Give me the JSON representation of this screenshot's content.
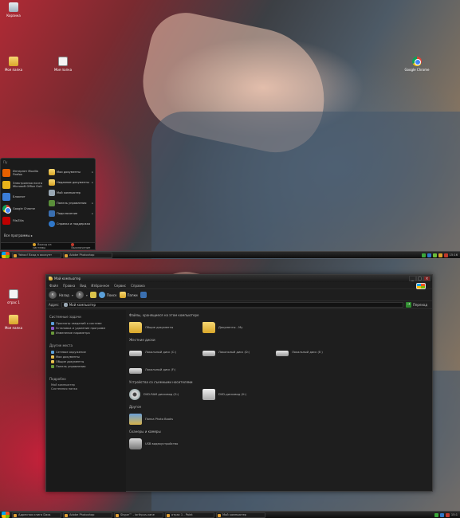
{
  "top": {
    "desktop_icons": [
      {
        "label": "Корзина",
        "icon": "recycle-bin-icon"
      },
      {
        "label": "Моя папка",
        "icon": "folder-icon"
      },
      {
        "label": "Моя папка",
        "icon": "document-icon"
      },
      {
        "label": "Google Chrome",
        "icon": "chrome-icon"
      }
    ],
    "start_menu": {
      "user": "Пу",
      "programs": [
        {
          "label": "Интернет Mozilla Firefox",
          "icon": "firefox-icon",
          "color": "#e66000"
        },
        {
          "label": "Электронная почта Microsoft Office Outl",
          "icon": "outlook-icon",
          "color": "#e8b21a"
        },
        {
          "label": "Блокнот",
          "icon": "notepad-icon",
          "color": "#3b7dd8"
        },
        {
          "label": "Google Chrome",
          "icon": "chrome-icon",
          "color": "#34a853"
        },
        {
          "label": "FileZilla",
          "icon": "filezilla-icon",
          "color": "#bf0000"
        }
      ],
      "places": [
        {
          "label": "Мои документы",
          "icon": "documents-icon",
          "arrow": "▸"
        },
        {
          "label": "Недавние документы",
          "icon": "recent-docs-icon",
          "arrow": "▸"
        },
        {
          "label": "Мой компьютер",
          "icon": "my-computer-icon",
          "arrow": ""
        },
        {
          "label": "Панель управления",
          "icon": "control-panel-icon",
          "arrow": "▸"
        },
        {
          "label": "Подключение",
          "icon": "connect-icon",
          "arrow": "▸"
        },
        {
          "label": "Справка и поддержка",
          "icon": "help-icon",
          "arrow": ""
        }
      ],
      "all_programs": "Все программы ▸",
      "logoff": "Выход из системы",
      "shutdown": "Выключение"
    },
    "taskbar": {
      "items": [
        "Yahoo! Вход в аккаунт",
        "Adobe Photoshop"
      ],
      "clock": "15:16"
    }
  },
  "bottom": {
    "desktop_icons": [
      {
        "label": "отрас 1",
        "icon": "document-icon"
      },
      {
        "label": "Моя папка",
        "icon": "folder-icon"
      }
    ],
    "explorer": {
      "title": "Мой компьютер",
      "menu": [
        "Файл",
        "Правка",
        "Вид",
        "Избранное",
        "Сервис",
        "Справка"
      ],
      "toolbar": {
        "back": "Назад",
        "search": "Поиск",
        "folders": "Папки"
      },
      "address": {
        "label": "Адрес",
        "value": "Мой компьютер",
        "go": "Переход"
      },
      "tasks": [
        {
          "title": "Системные задачи",
          "links": [
            "Просмотр сведений о системе",
            "Установка и удаление программ",
            "Изменение параметра"
          ]
        },
        {
          "title": "Другие места",
          "links": [
            "Сетевое окружение",
            "Мои документы",
            "Общие документы",
            "Панель управления"
          ]
        }
      ],
      "details": {
        "title": "Подробно",
        "lines": [
          "Мой компьютер",
          "Системная папка"
        ]
      },
      "sections": [
        {
          "header": "Файлы, хранящиеся на этом компьютере",
          "items": [
            {
              "label": "Общие документы",
              "icon": "folder-icon"
            },
            {
              "label": "Документы - My",
              "icon": "folder-icon"
            }
          ]
        },
        {
          "header": "Жесткие диски",
          "items": [
            {
              "label": "Локальный диск (C:)",
              "icon": "hard-drive-icon"
            },
            {
              "label": "Локальный диск (D:)",
              "icon": "hard-drive-icon"
            },
            {
              "label": "Локальный диск (E:)",
              "icon": "hard-drive-icon"
            },
            {
              "label": "Локальный диск (F:)",
              "icon": "hard-drive-icon"
            }
          ]
        },
        {
          "header": "Устройства со съемными носителями",
          "items": [
            {
              "label": "DVD-RAM дисковод (G:)",
              "icon": "dvd-drive-icon"
            },
            {
              "label": "DVD-дисковод (H:)",
              "icon": "dvd-drive-icon"
            }
          ]
        },
        {
          "header": "Другое",
          "items": [
            {
              "label": "Папка Photo Books",
              "icon": "shared-folder-icon"
            }
          ]
        },
        {
          "header": "Сканеры и камеры",
          "items": [
            {
              "label": "USB видеоустройство",
              "icon": "camera-icon"
            }
          ]
        }
      ]
    },
    "taskbar": {
      "items": [
        "Адресная книга Daos",
        "Adobe Photoshop",
        "Skype™ - lorthpus.vane",
        "отрас 1 - Paint",
        "Мой компьютер"
      ],
      "clock": "15:1"
    }
  }
}
